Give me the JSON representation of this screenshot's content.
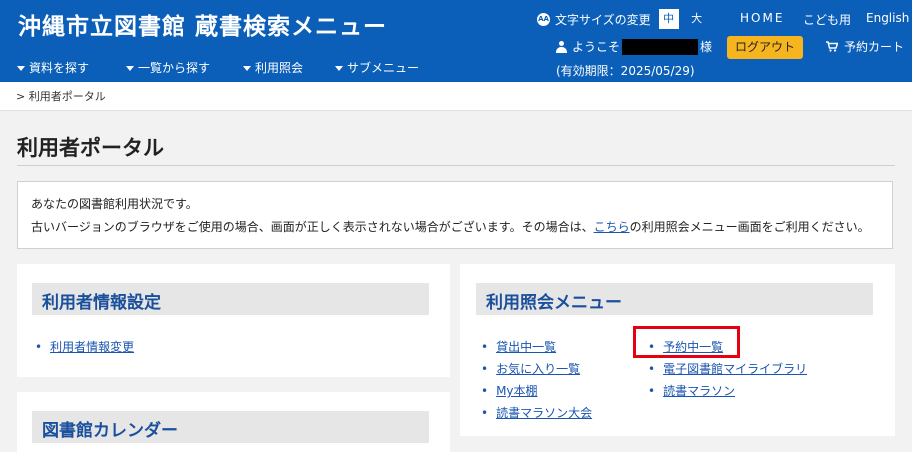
{
  "header": {
    "site_title": "沖縄市立図書館 蔵書検索メニュー",
    "font_size_label": "文字サイズの変更",
    "font_size_icon_text": "AA",
    "size_medium": "中",
    "size_large": "大",
    "nav": {
      "home": "HOME",
      "kids": "こども用",
      "english": "English"
    },
    "menus": [
      "資料を探す",
      "一覧から探す",
      "利用照会",
      "サブメニュー"
    ],
    "welcome_prefix": "ようこそ",
    "welcome_suffix": "様",
    "validity": "(有効期限：2025/05/29)",
    "logout": "ログアウト",
    "cart": "予約カート"
  },
  "breadcrumb": "> 利用者ポータル",
  "page_title": "利用者ポータル",
  "notice": {
    "line1": "あなたの図書館利用状況です。",
    "line2_before": "古いバージョンのブラウザをご使用の場合、画面が正しく表示されない場合がございます。その場合は、",
    "line2_link": "こちら",
    "line2_after": "の利用照会メニュー画面をご利用ください。"
  },
  "panels": {
    "user_settings": {
      "title": "利用者情報設定",
      "items": [
        "利用者情報変更"
      ]
    },
    "calendar": {
      "title": "図書館カレンダー"
    },
    "inquiry": {
      "title": "利用照会メニュー",
      "col1": [
        "貸出中一覧",
        "お気に入り一覧",
        "My本棚",
        "読書マラソン大会"
      ],
      "col2": [
        "予約中一覧",
        "電子図書館マイライブラリ",
        "読書マラソン"
      ]
    }
  },
  "colors": {
    "header_bg": "#0b5fb8",
    "accent_button": "#f6b51f",
    "highlight": "#e60012",
    "link": "#1a55b0"
  },
  "highlighted_item": "予約中一覧"
}
